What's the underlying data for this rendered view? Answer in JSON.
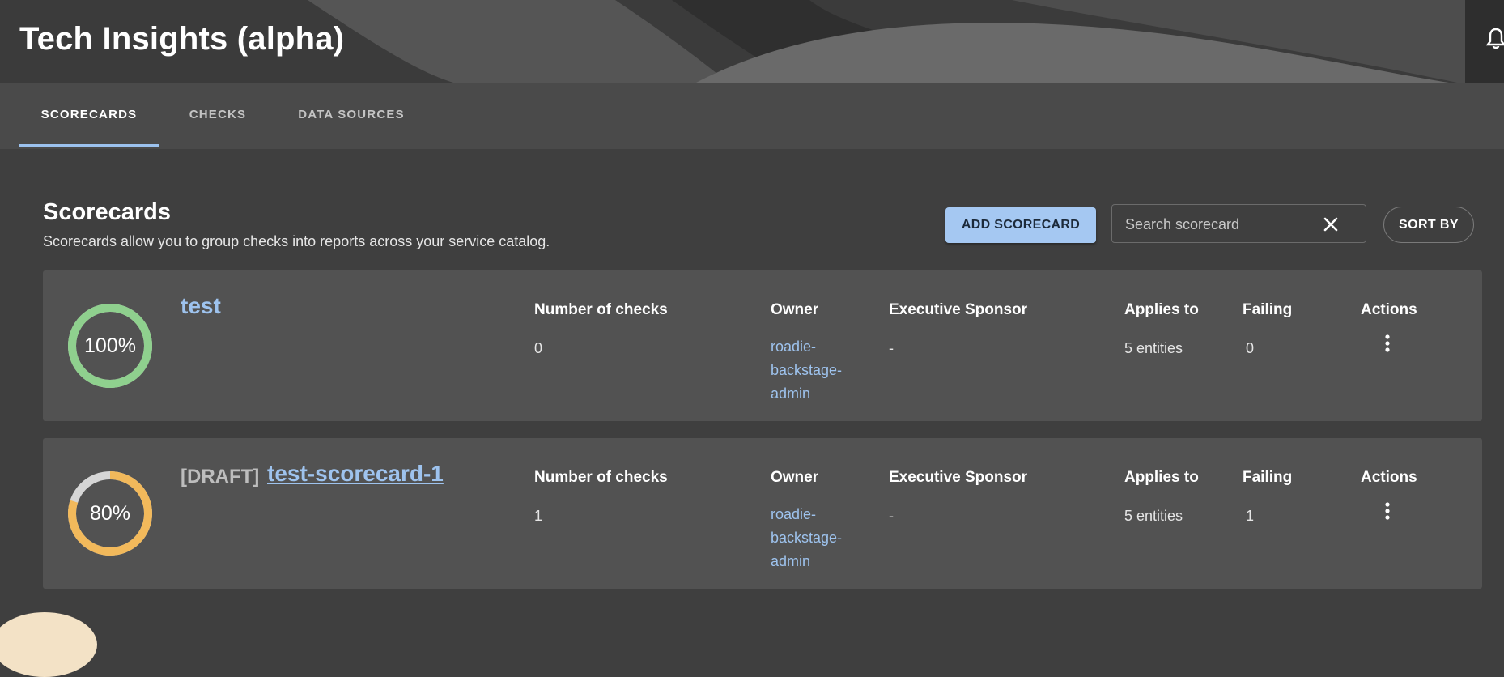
{
  "header": {
    "title": "Tech Insights (alpha)"
  },
  "tabs": [
    {
      "label": "SCORECARDS",
      "active": true
    },
    {
      "label": "CHECKS",
      "active": false
    },
    {
      "label": "DATA SOURCES",
      "active": false
    }
  ],
  "section": {
    "title": "Scorecards",
    "description": "Scorecards allow you to group checks into reports across your service catalog."
  },
  "toolbar": {
    "add_label": "ADD SCORECARD",
    "search_placeholder": "Search scorecard",
    "sort_label": "SORT BY"
  },
  "columns": {
    "checks": "Number of checks",
    "owner": "Owner",
    "sponsor": "Executive Sponsor",
    "applies": "Applies to",
    "failing": "Failing",
    "actions": "Actions"
  },
  "scorecards": [
    {
      "draft_label": "",
      "name": "test",
      "percent_label": "100%",
      "percent_value": 100,
      "color": "#8fd08e",
      "checks": "0",
      "owner_lines": [
        "roadie-",
        "backstage-",
        "admin"
      ],
      "sponsor": "-",
      "applies": "5 entities",
      "failing": "0"
    },
    {
      "draft_label": "[DRAFT]",
      "name": "test-scorecard-1",
      "percent_label": "80%",
      "percent_value": 80,
      "color": "#f2b95b",
      "checks": "1",
      "owner_lines": [
        "roadie-",
        "backstage-",
        "admin"
      ],
      "sponsor": "-",
      "applies": "5 entities",
      "failing": "1"
    }
  ],
  "colors": {
    "accent": "#9ec3ee",
    "button_bg": "#a5c8f2",
    "card_bg": "#525252",
    "page_bg": "#3f3f3f",
    "gauge_track": "#d6d6d6"
  },
  "icons": {
    "notifications": "bell-icon",
    "clear_search": "close-icon",
    "actions": "more-vertical-icon"
  }
}
